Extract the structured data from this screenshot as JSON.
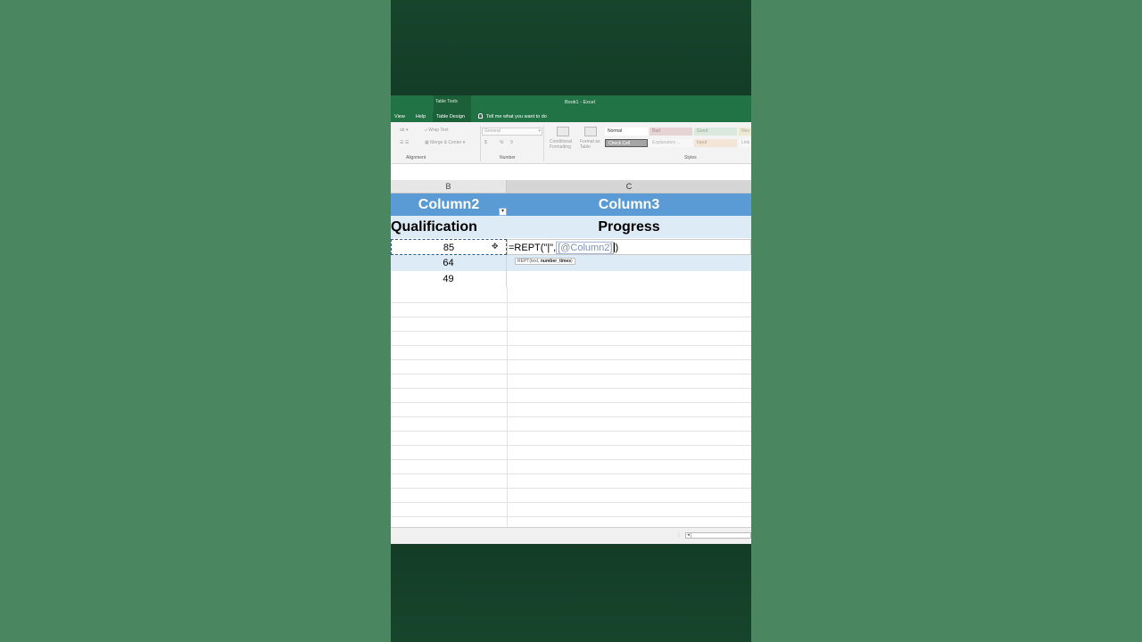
{
  "titlebar": {
    "context_label": "Table Tools",
    "doc_title": "Book1  -  Excel",
    "tabs": [
      "View",
      "Help",
      "Table Design"
    ],
    "active_tab": "Table Design",
    "tell_me": "Tell me what you want to do"
  },
  "ribbon": {
    "wrap_text": "Wrap Text",
    "merge_center": "Merge & Center",
    "alignment_label": "Alignment",
    "number_format": "General",
    "currency": "$",
    "percent": "%",
    "comma": "9",
    "number_label": "Number",
    "conditional_formatting": "Conditional Formatting",
    "format_as_table": "Format as Table",
    "styles_label": "Styles",
    "styles": {
      "normal": "Normal",
      "bad": "Bad",
      "good": "Good",
      "neutral": "Neu",
      "check_cell": "Check Cell",
      "explanatory": "Explanatory ...",
      "input": "Input",
      "linked": "Link"
    }
  },
  "columns": {
    "b": "B",
    "c": "C"
  },
  "table": {
    "header": [
      "Column2",
      "Column3"
    ],
    "subheader": [
      "Qualification",
      "Progress"
    ],
    "rows": [
      {
        "qualification": "85"
      },
      {
        "qualification": "64"
      },
      {
        "qualification": "49"
      }
    ]
  },
  "formula": {
    "prefix": "=REPT(\"|\",",
    "ref": "[@Column2]",
    "suffix": ")"
  },
  "tooltip": {
    "fn": "REPT(text, ",
    "arg": "number_times",
    "close": ")"
  }
}
